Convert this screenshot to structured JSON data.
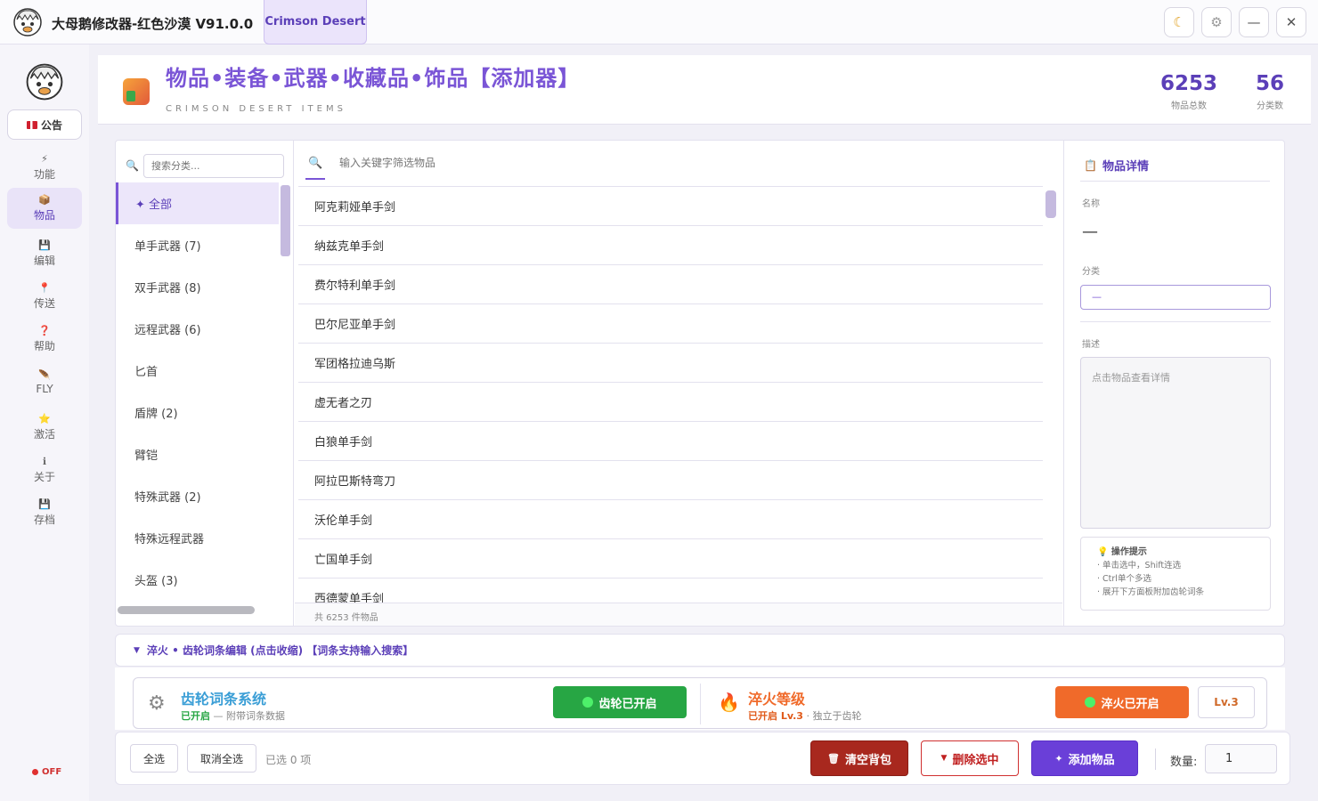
{
  "titlebar": {
    "title": "大母鹅修改器-红色沙漠  V91.0.0",
    "tab": "Crimson Desert",
    "theme_icon": "moon-icon",
    "settings_icon": "gear-icon",
    "minimize": "—",
    "close": "✕"
  },
  "sidebar": {
    "notice": "公告",
    "items": [
      {
        "label": "功能",
        "icon": "⚡"
      },
      {
        "label": "物品",
        "icon": "📦"
      },
      {
        "label": "编辑",
        "icon": "💾"
      },
      {
        "label": "传送",
        "icon": "📍"
      },
      {
        "label": "帮助",
        "icon": "❓"
      },
      {
        "label": "FLY",
        "icon": "🪶"
      },
      {
        "label": "激活",
        "icon": "⭐"
      },
      {
        "label": "关于",
        "icon": "ℹ"
      },
      {
        "label": "存档",
        "icon": "💾"
      }
    ],
    "status": "OFF"
  },
  "header": {
    "title": "物品•装备•武器•收藏品•饰品【添加器】",
    "subtitle": "CRIMSON DESERT ITEMS",
    "stats": [
      {
        "value": "6253",
        "label": "物品总数"
      },
      {
        "value": "56",
        "label": "分类数"
      }
    ]
  },
  "categories": {
    "search_placeholder": "搜索分类...",
    "items": [
      "✦ 全部",
      "单手武器 (7)",
      "双手武器 (8)",
      "远程武器 (6)",
      "匕首",
      "盾牌 (2)",
      "臂铠",
      "特殊武器 (2)",
      "特殊远程武器",
      "头盔 (3)"
    ]
  },
  "items": {
    "search_placeholder": "输入关键字筛选物品",
    "rows": [
      "阿克莉娅单手剑",
      "纳兹克单手剑",
      "费尔特利单手剑",
      "巴尔尼亚单手剑",
      "军团格拉迪乌斯",
      "虚无者之刃",
      "白狼单手剑",
      "阿拉巴斯特弯刀",
      "沃伦单手剑",
      "亡国单手剑",
      "西德蒙单手剑"
    ],
    "count_text": "共 6253 件物品"
  },
  "detail": {
    "header": "物品详情",
    "name_label": "名称",
    "name_value": "—",
    "category_label": "分类",
    "category_value": "—",
    "desc_label": "描述",
    "desc_placeholder": "点击物品查看详情",
    "tips_title": "💡 操作提示",
    "tips": [
      "· 单击选中，Shift连选",
      "· Ctrl单个多选",
      "· 展开下方面板附加齿轮词条"
    ]
  },
  "forge": {
    "bar_label": "淬火 • 齿轮词条编辑 (点击收缩) 【词条支持输入搜索】",
    "gear_title": "齿轮词条系统",
    "gear_status_on": "已开启",
    "gear_status_rest": " — 附带词条数据",
    "gear_button": "齿轮已开启",
    "temper_title": "淬火等级",
    "temper_status_on": "已开启 Lv.3",
    "temper_status_rest": " · 独立于齿轮",
    "temper_button": "淬火已开启",
    "level": "Lv.3"
  },
  "bottom": {
    "select_all": "全选",
    "deselect_all": "取消全选",
    "selected": "已选 0 项",
    "clear_bag": "清空背包",
    "delete_selected": "删除选中",
    "add_items": "添加物品",
    "qty_label": "数量:",
    "qty_value": "1"
  },
  "colors": {
    "accent": "#7a55d6",
    "green": "#27a644",
    "orange": "#f06a2a",
    "red": "#a8281e",
    "purple": "#6a3fd8"
  }
}
